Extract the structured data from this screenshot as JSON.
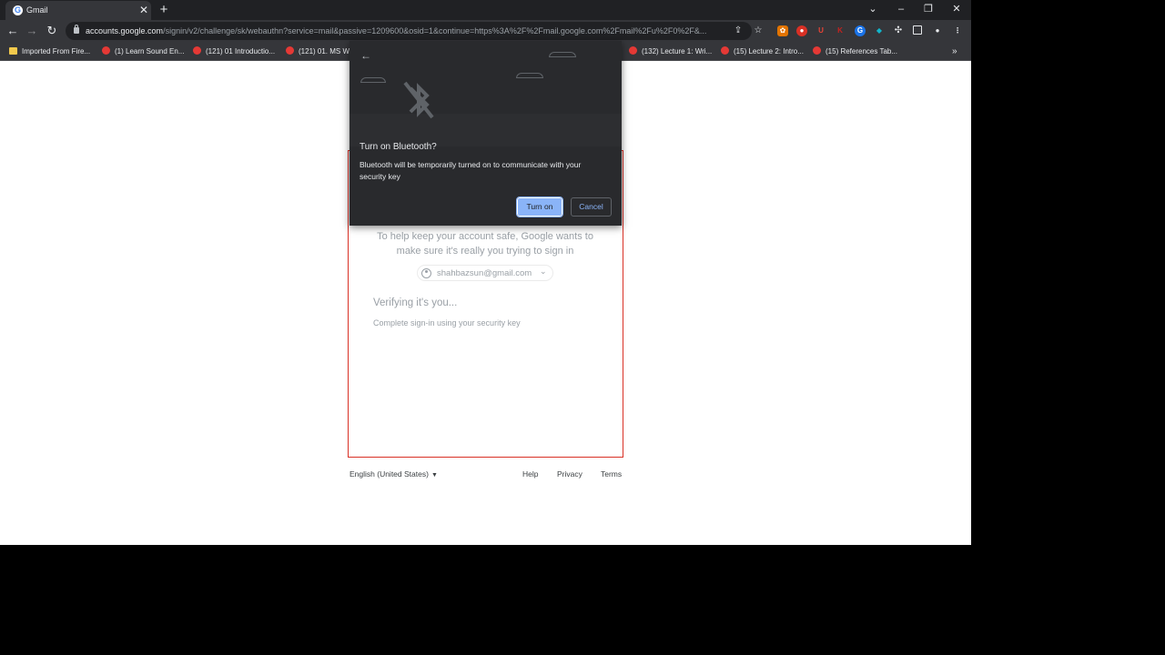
{
  "tab": {
    "title": "Gmail",
    "favicon": "G"
  },
  "address_bar": {
    "host": "accounts.google.com",
    "path": "/signin/v2/challenge/sk/webauthn?service=mail&passive=1209600&osid=1&continue=https%3A%2F%2Fmail.google.com%2Fmail%2Fu%2F0%2F&..."
  },
  "bookmarks": [
    {
      "label": "Imported From Fire...",
      "icon": "folder-icon"
    },
    {
      "label": "(1) Learn Sound En...",
      "icon": "youtube-icon"
    },
    {
      "label": "(121) 01 Introductio...",
      "icon": "youtube-icon"
    },
    {
      "label": "(121) 01. MS W",
      "icon": "youtube-icon"
    },
    {
      "label": "(132) Lecture 1: Wri...",
      "icon": "youtube-icon"
    },
    {
      "label": "(15) Lecture 2: Intro...",
      "icon": "youtube-icon"
    },
    {
      "label": "(15) References Tab...",
      "icon": "youtube-icon"
    }
  ],
  "dialog": {
    "title": "Turn on Bluetooth?",
    "body": "Bluetooth will be temporarily turned on to communicate with your security key",
    "primary_button": "Turn on",
    "secondary_button": "Cancel",
    "icon": "bluetooth-disabled-icon"
  },
  "page": {
    "help_text": "To help keep your account safe, Google wants to make sure it's really you trying to sign in",
    "account_email": "shahbazsun@gmail.com",
    "verify_title": "Verifying it's you...",
    "verify_subtitle": "Complete sign-in using your security key"
  },
  "footer": {
    "language": "English (United States)",
    "links": [
      "Help",
      "Privacy",
      "Terms"
    ]
  },
  "colors": {
    "accent": "#8ab4f8",
    "frame_border": "#d93025",
    "chrome_dark": "#202124"
  }
}
